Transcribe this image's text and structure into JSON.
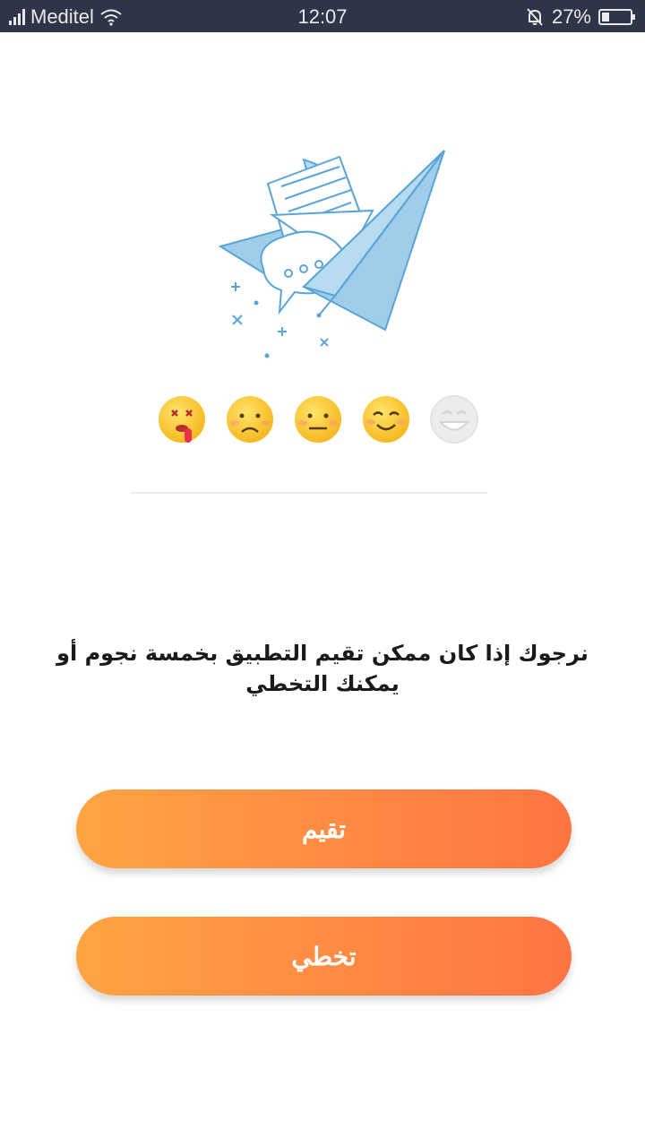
{
  "status_bar": {
    "carrier": "Meditel",
    "time": "12:07",
    "battery": "27%",
    "battery_level": 0.27,
    "icons": [
      "signal-icon",
      "wifi-icon",
      "mute-icon",
      "battery-icon"
    ]
  },
  "illustration": {
    "icon": "paper-plane-icon",
    "emojis": [
      "dizzy-tongue-emoji",
      "sad-emoji",
      "neutral-emoji",
      "happy-emoji",
      "grinning-emoji"
    ]
  },
  "prompt": {
    "line1": "نرجوك إذا كان ممكن تقيم التطبيق بخمسة نجوم أو",
    "line2": "يمكنك التخطي"
  },
  "buttons": {
    "rate_label": "تقيم",
    "skip_label": "تخطي"
  },
  "colors": {
    "status_bar_bg": "#2f3446",
    "button_gradient_start": "#ffa443",
    "button_gradient_end": "#ff7442",
    "plane_blue": "#9fcdea",
    "line_blue": "#5aa5d8",
    "emoji_yellow": "#fbd43a"
  }
}
